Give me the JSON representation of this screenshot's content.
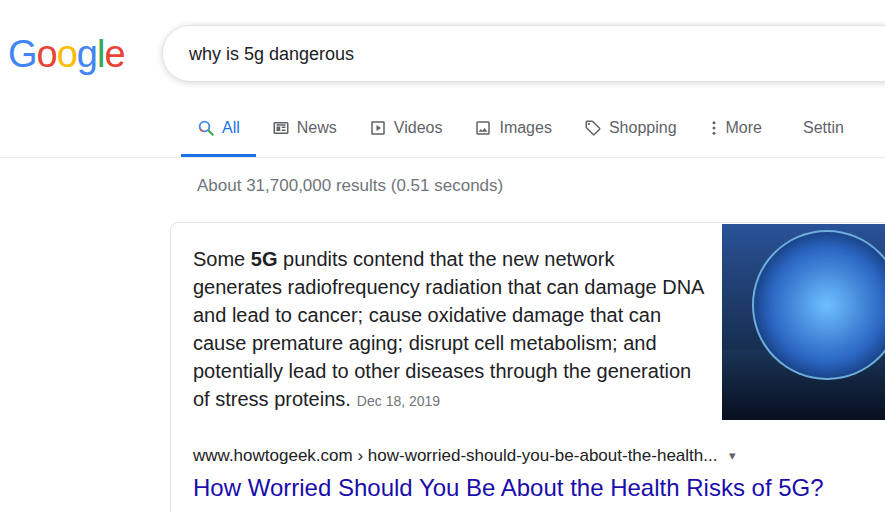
{
  "logo": {
    "letters": [
      {
        "char": "G",
        "color": "#4285F4"
      },
      {
        "char": "o",
        "color": "#EA4335"
      },
      {
        "char": "o",
        "color": "#FBBC05"
      },
      {
        "char": "g",
        "color": "#4285F4"
      },
      {
        "char": "l",
        "color": "#34A853"
      },
      {
        "char": "e",
        "color": "#EA4335"
      }
    ]
  },
  "search": {
    "query": "why is 5g dangerous"
  },
  "tabs": [
    {
      "label": "All",
      "selected": true
    },
    {
      "label": "News",
      "selected": false
    },
    {
      "label": "Videos",
      "selected": false
    },
    {
      "label": "Images",
      "selected": false
    },
    {
      "label": "Shopping",
      "selected": false
    },
    {
      "label": "More",
      "selected": false
    }
  ],
  "settings": "Settin",
  "result_stats": "About 31,700,000 results (0.51 seconds)",
  "featured_snippet": {
    "segments": [
      {
        "text": "Some ",
        "bold": false
      },
      {
        "text": "5G",
        "bold": true
      },
      {
        "text": " pundits contend that the new network generates radiofrequency radiation that can damage DNA and lead to cancer; cause oxidative damage that can cause premature aging; disrupt cell metabolism; and potentially lead to other diseases through the generation of stress proteins.",
        "bold": false
      }
    ],
    "date": "Dec 18, 2019",
    "url": "www.howtogeek.com › how-worried-should-you-be-about-the-health...",
    "url_menu": "▾",
    "title": "How Worried Should You Be About the Health Risks of 5G?"
  }
}
